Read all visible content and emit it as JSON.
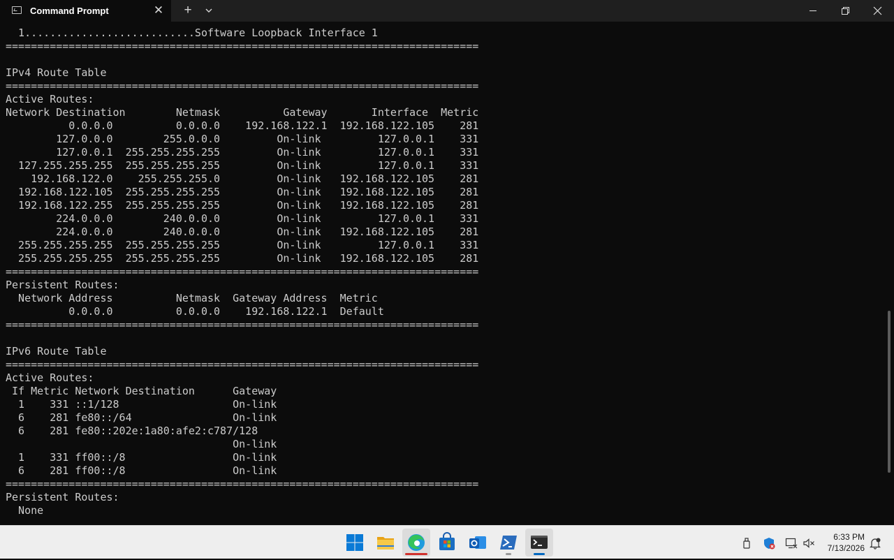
{
  "window": {
    "tab_title": "Command Prompt",
    "tab_close": "✕",
    "new_tab": "+"
  },
  "terminal_lines": [
    "  1...........................Software Loopback Interface 1",
    "===========================================================================",
    "",
    "IPv4 Route Table",
    "===========================================================================",
    "Active Routes:",
    "Network Destination        Netmask          Gateway       Interface  Metric",
    "          0.0.0.0          0.0.0.0    192.168.122.1  192.168.122.105    281",
    "        127.0.0.0        255.0.0.0         On-link         127.0.0.1    331",
    "        127.0.0.1  255.255.255.255         On-link         127.0.0.1    331",
    "  127.255.255.255  255.255.255.255         On-link         127.0.0.1    331",
    "    192.168.122.0    255.255.255.0         On-link   192.168.122.105    281",
    "  192.168.122.105  255.255.255.255         On-link   192.168.122.105    281",
    "  192.168.122.255  255.255.255.255         On-link   192.168.122.105    281",
    "        224.0.0.0        240.0.0.0         On-link         127.0.0.1    331",
    "        224.0.0.0        240.0.0.0         On-link   192.168.122.105    281",
    "  255.255.255.255  255.255.255.255         On-link         127.0.0.1    331",
    "  255.255.255.255  255.255.255.255         On-link   192.168.122.105    281",
    "===========================================================================",
    "Persistent Routes:",
    "  Network Address          Netmask  Gateway Address  Metric",
    "          0.0.0.0          0.0.0.0    192.168.122.1  Default",
    "===========================================================================",
    "",
    "IPv6 Route Table",
    "===========================================================================",
    "Active Routes:",
    " If Metric Network Destination      Gateway",
    "  1    331 ::1/128                  On-link",
    "  6    281 fe80::/64                On-link",
    "  6    281 fe80::202e:1a80:afe2:c787/128",
    "                                    On-link",
    "  1    331 ff00::/8                 On-link",
    "  6    281 ff00::/8                 On-link",
    "===========================================================================",
    "Persistent Routes:",
    "  None"
  ],
  "taskbar": {
    "apps": [
      {
        "name": "start-icon"
      },
      {
        "name": "file-explorer-icon"
      },
      {
        "name": "edge-icon"
      },
      {
        "name": "microsoft-store-icon"
      },
      {
        "name": "outlook-icon"
      },
      {
        "name": "powershell-icon"
      },
      {
        "name": "terminal-icon"
      }
    ],
    "clock": {
      "time": "6:33 PM",
      "date": "7/13/2026"
    }
  },
  "colors": {
    "terminal_bg": "#0c0c0c",
    "terminal_fg": "#cccccc",
    "titlebar_bg": "#1f1f1f",
    "taskbar_bg": "#eeeeee",
    "accent": "#0067c0"
  }
}
